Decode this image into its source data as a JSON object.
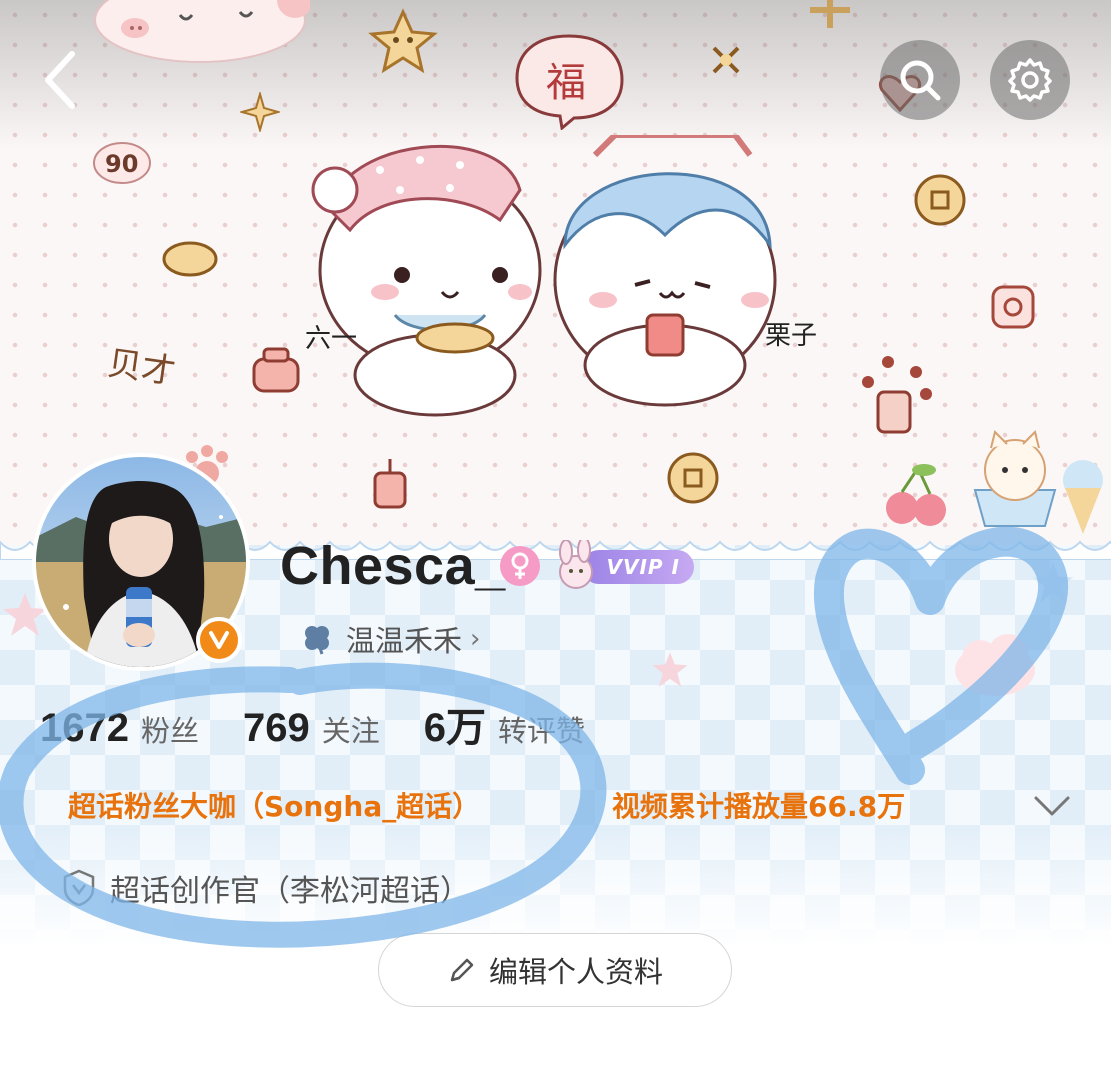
{
  "banner": {
    "sticker_left": "六一",
    "sticker_right": "栗子",
    "fortune_char": "福",
    "wealth_chars": "贝才"
  },
  "nav": {
    "back": "back",
    "search": "search",
    "settings": "settings"
  },
  "profile": {
    "username": "Chesca_",
    "vip_label": "VVIP I",
    "group_name": "温温禾禾",
    "group_chevron": "›"
  },
  "stats": [
    {
      "value": "1672",
      "label": "粉丝"
    },
    {
      "value": "769",
      "label": "关注"
    },
    {
      "value": "6万",
      "label": "转评赞"
    }
  ],
  "tags": {
    "fan_title": "超话粉丝大咖（Songha_超话）",
    "video_plays": "视频累计播放量66.8万",
    "creator_title": "超话创作官（李松河超话）"
  },
  "actions": {
    "edit_profile": "编辑个人资料"
  },
  "colors": {
    "accent_orange": "#e8720c",
    "verified_orange": "#f28a17",
    "vip_purple": "#9b83e6",
    "gender_pink": "#f59bc5",
    "scribble_blue": "#7fb6e8"
  }
}
